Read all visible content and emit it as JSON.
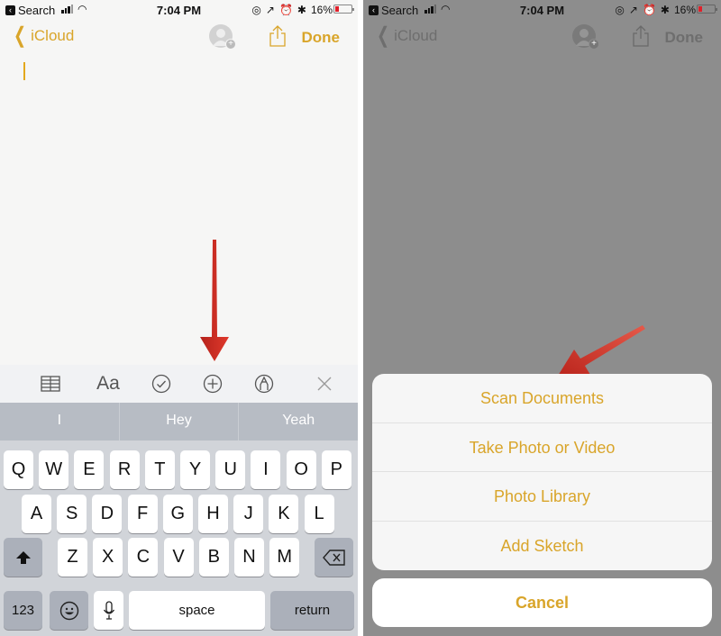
{
  "accent_color": "#d9a52a",
  "status_bar": {
    "back_app_label": "Search",
    "time": "7:04 PM",
    "battery_percent": "16%"
  },
  "left_screen": {
    "nav": {
      "back_label": "iCloud",
      "done_label": "Done"
    },
    "toolbar": {
      "icons": [
        "table-icon",
        "text-format-icon",
        "checklist-icon",
        "add-icon",
        "markup-icon",
        "close-icon"
      ],
      "format_label": "Aa"
    },
    "suggestions": [
      "I",
      "Hey",
      "Yeah"
    ],
    "keyboard": {
      "row1": [
        "Q",
        "W",
        "E",
        "R",
        "T",
        "Y",
        "U",
        "I",
        "O",
        "P"
      ],
      "row2": [
        "A",
        "S",
        "D",
        "F",
        "G",
        "H",
        "J",
        "K",
        "L"
      ],
      "row3": [
        "Z",
        "X",
        "C",
        "V",
        "B",
        "N",
        "M"
      ],
      "numbers_label": "123",
      "space_label": "space",
      "return_label": "return"
    }
  },
  "right_screen": {
    "nav": {
      "back_label": "iCloud",
      "done_label": "Done"
    },
    "action_sheet": {
      "options": [
        "Scan Documents",
        "Take Photo or Video",
        "Photo Library",
        "Add Sketch"
      ],
      "cancel_label": "Cancel"
    }
  }
}
